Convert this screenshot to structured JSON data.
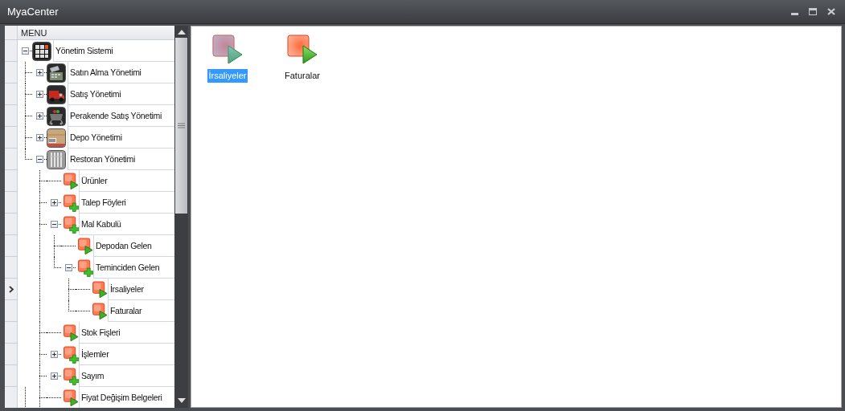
{
  "window": {
    "title": "MyaCenter"
  },
  "menu": {
    "header": "MENU",
    "tree": [
      {
        "label": "Yönetim Sistemi",
        "kind": "grid",
        "expanded": true,
        "selected": false,
        "children": [
          {
            "label": "Satın Alma Yönetimi",
            "kind": "register",
            "expanded": false,
            "selected": false
          },
          {
            "label": "Satış Yönetimi",
            "kind": "truck",
            "expanded": false,
            "selected": false
          },
          {
            "label": "Perakende Satış Yönetimi",
            "kind": "basket",
            "expanded": false,
            "selected": false
          },
          {
            "label": "Depo Yönetimi",
            "kind": "box",
            "expanded": false,
            "selected": false
          },
          {
            "label": "Restoran Yönetimi",
            "kind": "cutlery",
            "expanded": true,
            "selected": false,
            "children": [
              {
                "label": "Ürünler",
                "kind": "form",
                "selected": false
              },
              {
                "label": "Talep Föyleri",
                "kind": "folder",
                "expanded": false,
                "selected": false
              },
              {
                "label": "Mal Kabulü",
                "kind": "folder",
                "expanded": true,
                "selected": false,
                "children": [
                  {
                    "label": "Depodan Gelen",
                    "kind": "form",
                    "selected": false
                  },
                  {
                    "label": "Teminciden Gelen",
                    "kind": "folder",
                    "expanded": true,
                    "selected": false,
                    "children": [
                      {
                        "label": "İrsaliyeler",
                        "kind": "form",
                        "selected": true
                      },
                      {
                        "label": "Faturalar",
                        "kind": "form",
                        "selected": false
                      }
                    ]
                  }
                ]
              },
              {
                "label": "Stok Fişleri",
                "kind": "form",
                "selected": false
              },
              {
                "label": "İşlemler",
                "kind": "folder",
                "expanded": false,
                "selected": false
              },
              {
                "label": "Sayım",
                "kind": "folder",
                "expanded": false,
                "selected": false
              },
              {
                "label": "Fiyat Değişim Belgeleri",
                "kind": "form",
                "selected": false
              }
            ]
          }
        ]
      }
    ]
  },
  "content": {
    "items": [
      {
        "label": "İrsaliyeler",
        "selected": true
      },
      {
        "label": "Faturalar",
        "selected": false
      }
    ]
  }
}
